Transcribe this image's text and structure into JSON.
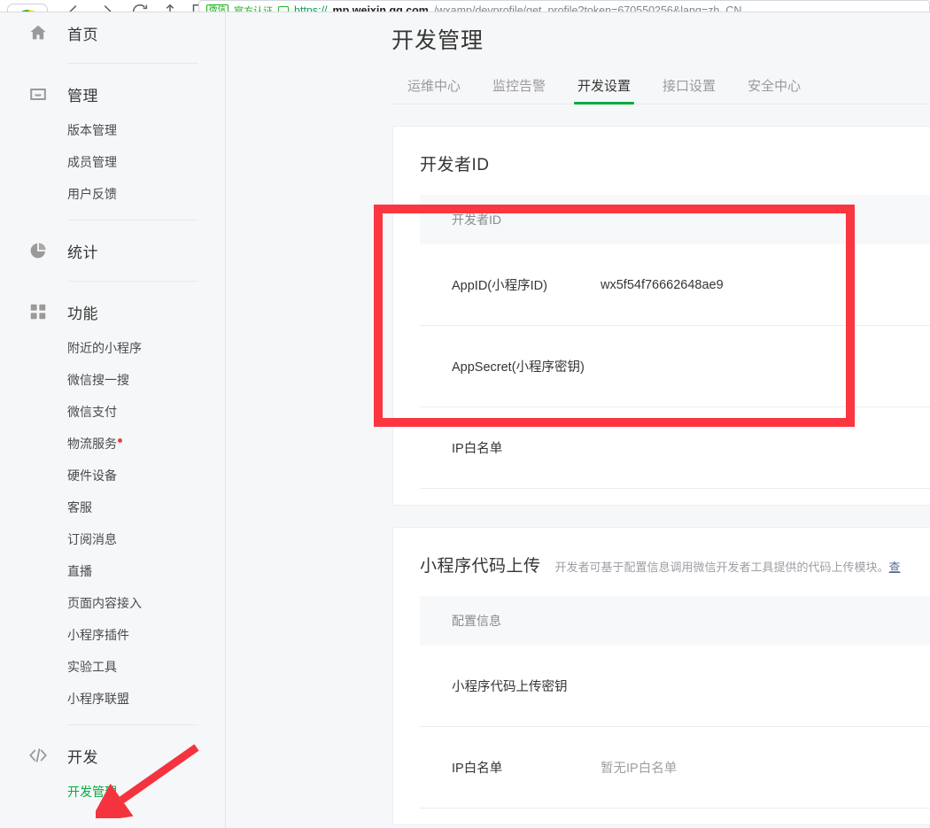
{
  "browser": {
    "url_badge": "微信",
    "url_badge_text": "官方认证",
    "url_scheme": "https://",
    "url_host": "mp.weixin.qq.com",
    "url_path": "/wxamp/devprofile/get_profile?token=670550256&lang=zh_CN",
    "icons": [
      "back-icon",
      "forward-icon",
      "reload-icon",
      "share-icon",
      "bookmark-icon"
    ]
  },
  "sidebar": {
    "groups": [
      {
        "icon": "home-icon",
        "label": "首页",
        "items": [],
        "divider_after": true
      },
      {
        "icon": "inbox-icon",
        "label": "管理",
        "items": [
          {
            "label": "版本管理",
            "active": false,
            "dot": false
          },
          {
            "label": "成员管理",
            "active": false,
            "dot": false
          },
          {
            "label": "用户反馈",
            "active": false,
            "dot": false
          }
        ],
        "divider_after": true
      },
      {
        "icon": "pie-chart-icon",
        "label": "统计",
        "items": [],
        "divider_after": true
      },
      {
        "icon": "grid-icon",
        "label": "功能",
        "items": [
          {
            "label": "附近的小程序",
            "active": false,
            "dot": false
          },
          {
            "label": "微信搜一搜",
            "active": false,
            "dot": false
          },
          {
            "label": "微信支付",
            "active": false,
            "dot": false
          },
          {
            "label": "物流服务",
            "active": false,
            "dot": true
          },
          {
            "label": "硬件设备",
            "active": false,
            "dot": false
          },
          {
            "label": "客服",
            "active": false,
            "dot": false
          },
          {
            "label": "订阅消息",
            "active": false,
            "dot": false
          },
          {
            "label": "直播",
            "active": false,
            "dot": false
          },
          {
            "label": "页面内容接入",
            "active": false,
            "dot": false
          },
          {
            "label": "小程序插件",
            "active": false,
            "dot": false
          },
          {
            "label": "实验工具",
            "active": false,
            "dot": false
          },
          {
            "label": "小程序联盟",
            "active": false,
            "dot": false
          }
        ],
        "divider_after": true
      },
      {
        "icon": "code-icon",
        "label": "开发",
        "items": [
          {
            "label": "开发管理",
            "active": true,
            "dot": false
          }
        ],
        "divider_after": false
      }
    ]
  },
  "main": {
    "title": "开发管理",
    "tabs": [
      {
        "label": "运维中心",
        "active": false
      },
      {
        "label": "监控告警",
        "active": false
      },
      {
        "label": "开发设置",
        "active": true
      },
      {
        "label": "接口设置",
        "active": false
      },
      {
        "label": "安全中心",
        "active": false
      }
    ],
    "cards": [
      {
        "title": "开发者ID",
        "desc": "",
        "desc_link": "",
        "table_header": "开发者ID",
        "rows": [
          {
            "label": "AppID(小程序ID)",
            "value": "wx5f54f76662648ae9",
            "muted": false
          },
          {
            "label": "AppSecret(小程序密钥)",
            "value": "",
            "muted": false
          },
          {
            "label": "IP白名单",
            "value": "",
            "muted": false
          }
        ]
      },
      {
        "title": "小程序代码上传",
        "desc": "开发者可基于配置信息调用微信开发者工具提供的代码上传模块。",
        "desc_link": "查",
        "table_header": "配置信息",
        "rows": [
          {
            "label": "小程序代码上传密钥",
            "value": "",
            "muted": false
          },
          {
            "label": "IP白名单",
            "value": "暂无IP白名单",
            "muted": true
          }
        ]
      }
    ]
  },
  "annotations": {
    "highlight_box_color": "#fb3640",
    "arrow_color": "#f5333f",
    "arrow_target": "开发管理"
  },
  "colors": {
    "accent_green": "#06ab3e",
    "link_blue": "#576b95",
    "page_bg": "#f6f7f9",
    "card_bg": "#ffffff",
    "text_primary": "#353535",
    "text_muted": "#9c9fa4"
  }
}
